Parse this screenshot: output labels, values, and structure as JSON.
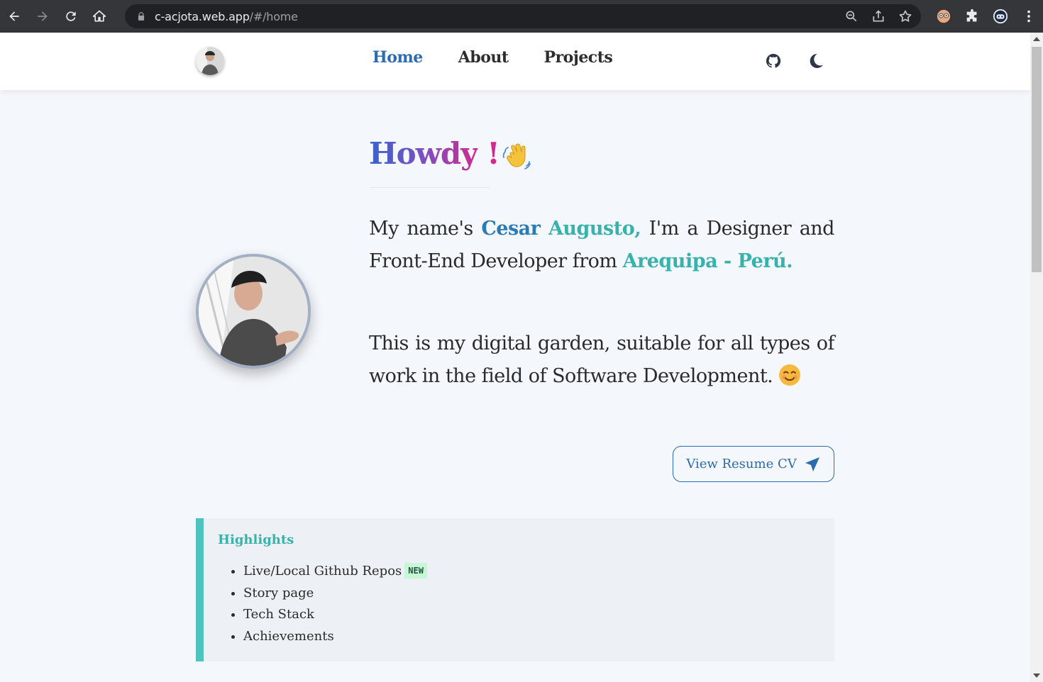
{
  "browser": {
    "url_host": "c-acjota.web.app",
    "url_path": "/#/home"
  },
  "header": {
    "nav": [
      {
        "label": "Home",
        "active": true
      },
      {
        "label": "About",
        "active": false
      },
      {
        "label": "Projects",
        "active": false
      }
    ],
    "icons": [
      "github-icon",
      "moon-icon"
    ]
  },
  "hero": {
    "greeting": "Howdy",
    "exclaim": "!",
    "intro": {
      "p1_a": "My name's ",
      "name_first": "Cesar",
      "name_last": "Augusto,",
      "p1_b": " I'm a Designer and Front-End Developer from ",
      "location": "Arequipa - Perú.",
      "p2": "This is my digital garden, suitable for all types of work in the field of Software Development."
    },
    "cv_button": "View Resume CV"
  },
  "highlights": {
    "title": "Highlights",
    "items": [
      "Live/Local Github Repos",
      "Story page",
      "Tech Stack",
      "Achievements"
    ],
    "badge": "NEW"
  },
  "colors": {
    "accent": "#2b6cb0",
    "teal": "#38b2ac",
    "highlight_border": "#4fc3c0"
  }
}
